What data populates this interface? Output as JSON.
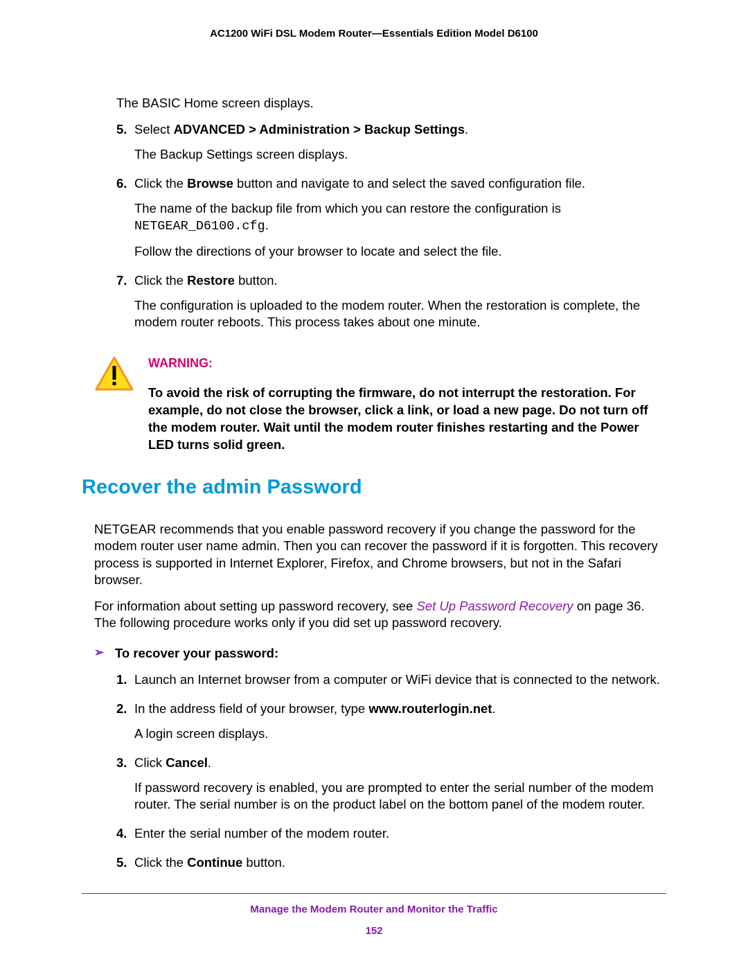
{
  "header": {
    "title": "AC1200 WiFi DSL Modem Router—Essentials Edition Model D6100"
  },
  "intro": {
    "basic_home": "The BASIC Home screen displays."
  },
  "steps_top": [
    {
      "num": "5.",
      "parts": [
        {
          "pre": "Select ",
          "bold": "ADVANCED > Administration > Backup Settings",
          "post": "."
        },
        {
          "text": "The Backup Settings screen displays."
        }
      ]
    },
    {
      "num": "6.",
      "parts": [
        {
          "pre": "Click the ",
          "bold": "Browse",
          "post": " button and navigate to and select the saved configuration file."
        },
        {
          "text_pre": "The name of the backup file from which you can restore the configuration is ",
          "mono": "NETGEAR_D6100.cfg",
          "text_post": "."
        },
        {
          "text": "Follow the directions of your browser to locate and select the file."
        }
      ]
    },
    {
      "num": "7.",
      "parts": [
        {
          "pre": "Click the ",
          "bold": "Restore",
          "post": " button."
        },
        {
          "text": "The configuration is uploaded to the modem router. When the restoration is complete, the modem router reboots. This process takes about one minute."
        }
      ]
    }
  ],
  "warning": {
    "label": "WARNING:",
    "text": "To avoid the risk of corrupting the firmware, do not interrupt the restoration. For example, do not close the browser, click a link, or load a new page. Do not turn off the modem router. Wait until the modem router finishes restarting and the Power LED turns solid green."
  },
  "section": {
    "heading": "Recover the admin Password",
    "p1": "NETGEAR recommends that you enable password recovery if you change the password for the modem router user name admin. Then you can recover the password if it is forgotten. This recovery process is supported in Internet Explorer, Firefox, and Chrome browsers, but not in the Safari browser.",
    "p2_pre": "For information about setting up password recovery, see ",
    "p2_link": "Set Up Password Recovery",
    "p2_post": " on page 36. The following procedure works only if you did set up password recovery."
  },
  "procedure": {
    "arrow": "➢",
    "title": "To recover your password:",
    "steps": [
      {
        "num": "1.",
        "parts": [
          {
            "text": "Launch an Internet browser from a computer or WiFi device that is connected to the network."
          }
        ]
      },
      {
        "num": "2.",
        "parts": [
          {
            "pre": "In the address field of your browser, type ",
            "bold": "www.routerlogin.net",
            "post": "."
          },
          {
            "text": "A login screen displays."
          }
        ]
      },
      {
        "num": "3.",
        "parts": [
          {
            "pre": "Click ",
            "bold": "Cancel",
            "post": "."
          },
          {
            "text": "If password recovery is enabled, you are prompted to enter the serial number of the modem router. The serial number is on the product label on the bottom panel of the modem router."
          }
        ]
      },
      {
        "num": "4.",
        "parts": [
          {
            "text": "Enter the serial number of the modem router."
          }
        ]
      },
      {
        "num": "5.",
        "parts": [
          {
            "pre": "Click the ",
            "bold": "Continue",
            "post": " button."
          }
        ]
      }
    ]
  },
  "footer": {
    "title": "Manage the Modem Router and Monitor the Traffic",
    "page": "152"
  }
}
